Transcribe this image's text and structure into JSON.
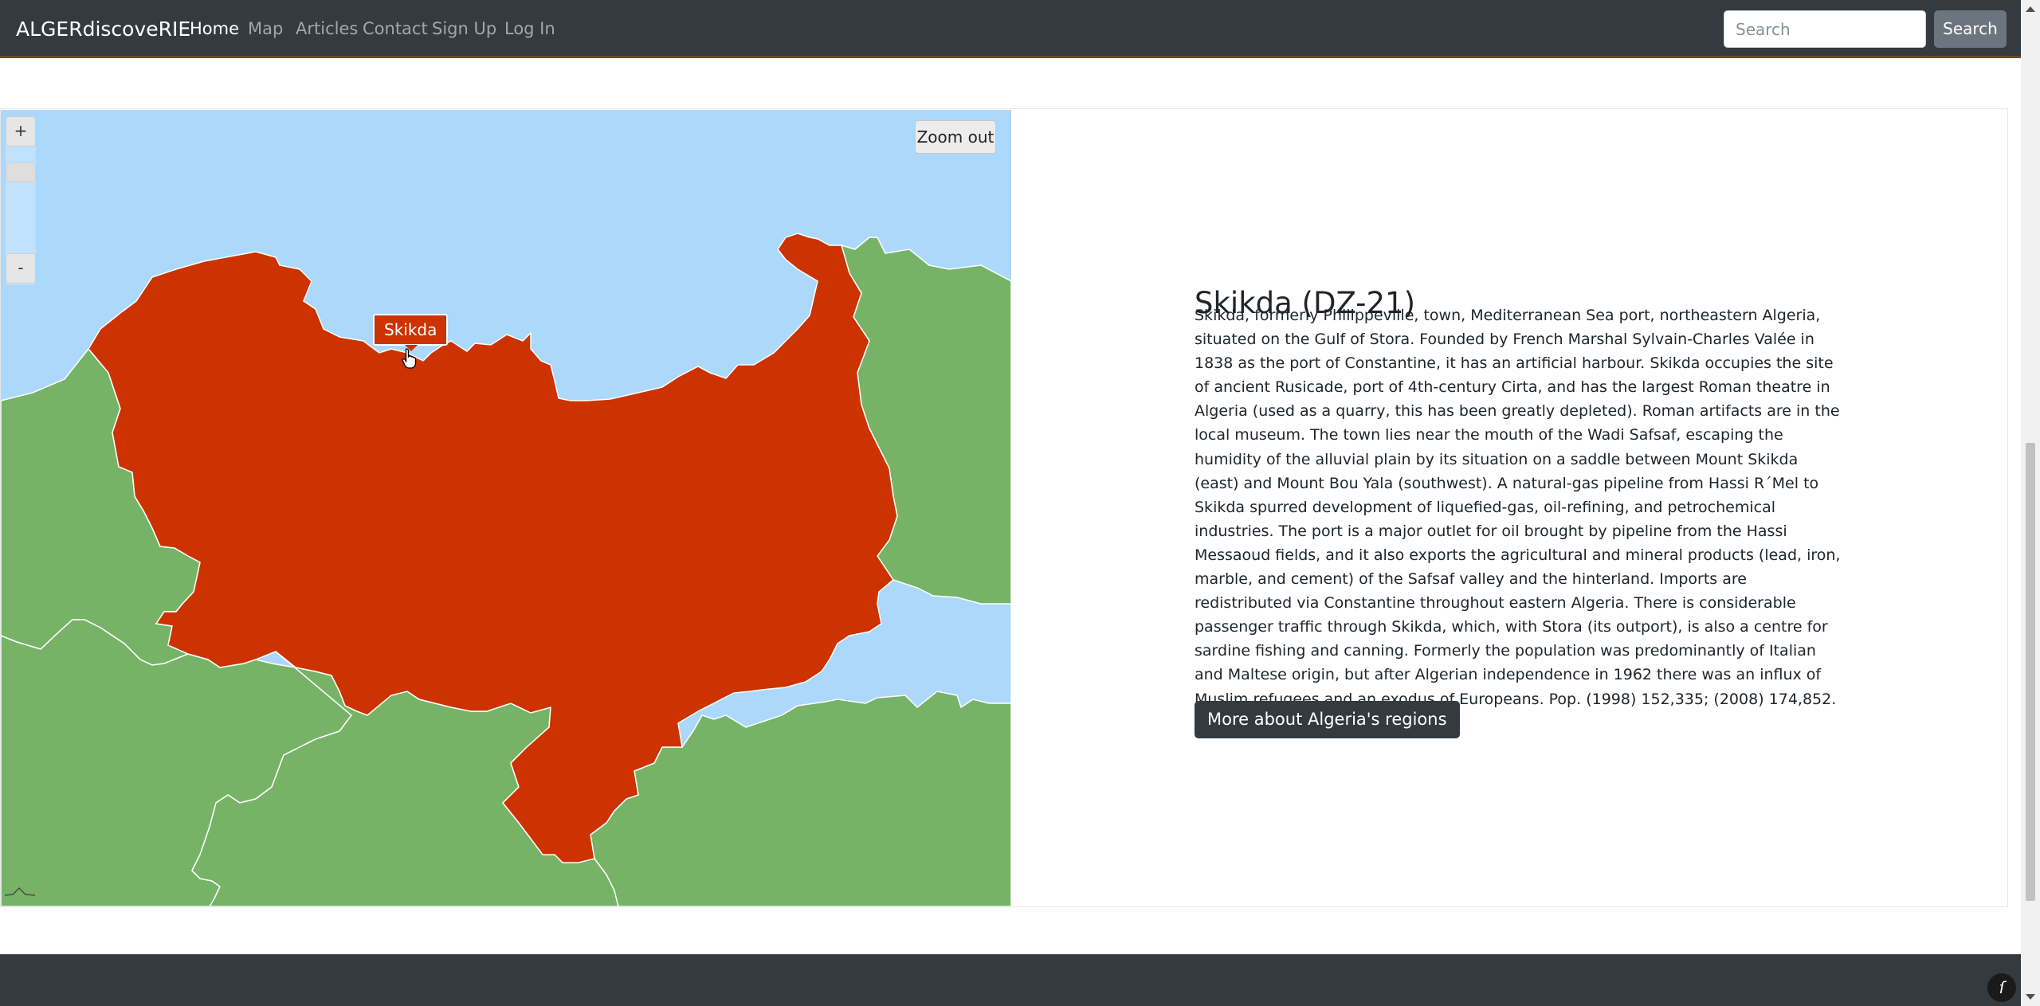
{
  "nav": {
    "brand": "ALGERdiscoveRIE",
    "links": [
      "Home",
      "Map",
      "Articles",
      "Contact",
      "Sign Up",
      "Log In"
    ],
    "search_placeholder": "Search",
    "search_button": "Search"
  },
  "map": {
    "zoom_in": "+",
    "zoom_out_small": "-",
    "zoom_out_button": "Zoom out",
    "selected_label": "Skikda",
    "colors": {
      "sea": "#abd8fb",
      "selected_region": "#cc3300",
      "other_regions": "#76b367",
      "borders": "#ffffff"
    }
  },
  "region": {
    "title": "Skikda (DZ-21)",
    "description": "Skikda, formerly Philippeville, town, Mediterranean Sea port, northeastern Algeria, situated on the Gulf of Stora. Founded by French Marshal Sylvain-Charles Valée in 1838 as the port of Constantine, it has an artificial harbour. Skikda occupies the site of ancient Rusicade, port of 4th-century Cirta, and has the largest Roman theatre in Algeria (used as a quarry, this has been greatly depleted). Roman artifacts are in the local museum. The town lies near the mouth of the Wadi Safsaf, escaping the humidity of the alluvial plain by its situation on a saddle between Mount Skikda (east) and Mount Bou Yala (southwest). A natural-gas pipeline from Hassi R΄Mel to Skikda spurred development of liquefied-gas, oil-refining, and petrochemical industries. The port is a major outlet for oil brought by pipeline from the Hassi Messaoud fields, and it also exports the agricultural and mineral products (lead, iron, marble, and cement) of the Safsaf valley and the hinterland. Imports are redistributed via Constantine throughout eastern Algeria. There is considerable passenger traffic through Skikda, which, with Stora (its outport), is also a centre for sardine fishing and canning. Formerly the population was predominantly of Italian and Maltese origin, but after Algerian independence in 1962 there was an influx of Muslim refugees and an exodus of Europeans. Pop. (1998) 152,335; (2008) 174,852.",
    "more_button": "More about Algeria's regions"
  }
}
